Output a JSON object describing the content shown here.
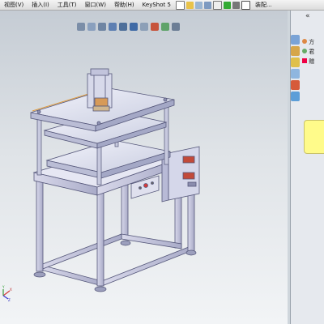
{
  "menubar": {
    "items": [
      "视图(V)",
      "插入(I)",
      "工具(T)",
      "窗口(W)",
      "帮助(H)",
      "KeyShot 5",
      "装配..."
    ]
  },
  "right_panel": {
    "collapse": "«",
    "tree": [
      {
        "label": "方"
      },
      {
        "label": "君"
      },
      {
        "label": "赠"
      }
    ]
  },
  "triad": {
    "x_label": "X",
    "y_label": "Y",
    "z_label": "Z"
  }
}
